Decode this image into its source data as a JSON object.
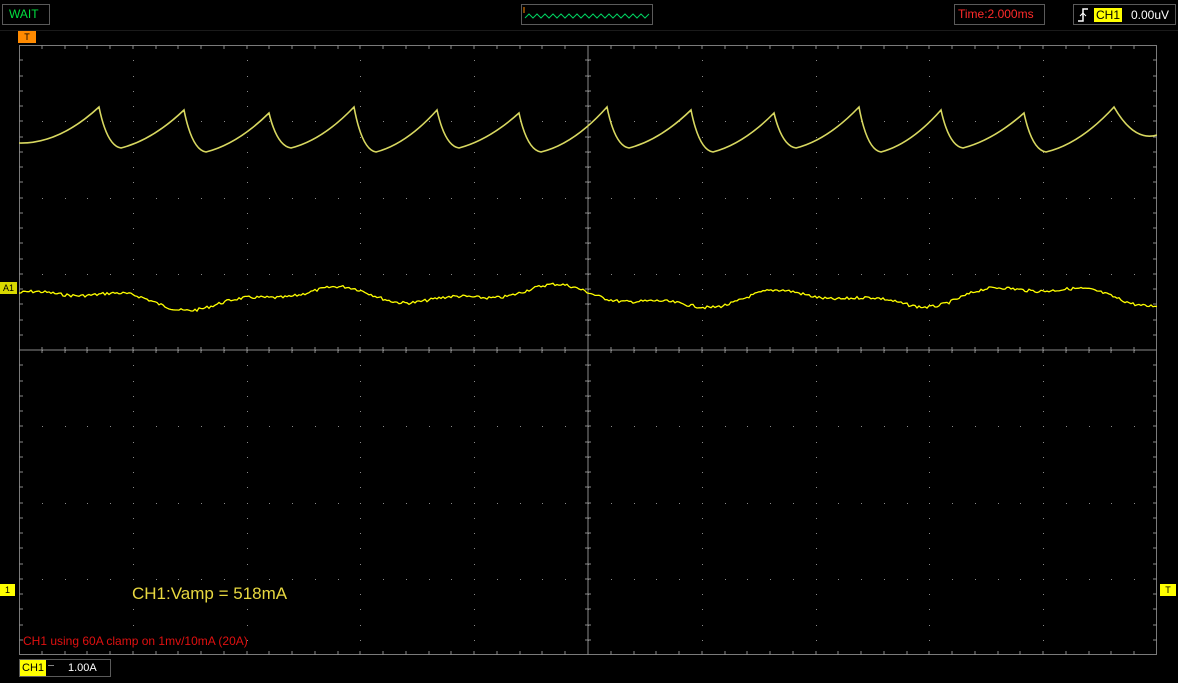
{
  "header": {
    "status": "WAIT",
    "timebase": "Time:2.000ms",
    "trigger": {
      "edge_icon": "rising-edge-icon",
      "channel": "CH1",
      "level": "0.00uV"
    }
  },
  "markers": {
    "trigger_position": "T",
    "reference": "A1",
    "channel": "1",
    "trigger_level": "T"
  },
  "measurement": "CH1:Vamp = 518mA",
  "note": "CH1 using 60A clamp on 1mv/10mA (20A)",
  "footer": {
    "channel_label": "CH1",
    "coupling_icon": "dc-coupling-icon",
    "scale": "1.00A"
  },
  "colors": {
    "trace_ch1": "#ffff00",
    "trace_ref": "#d8d860",
    "grid": "#6e6e6e",
    "status": "#00e040",
    "time": "#ff2a2a"
  }
}
